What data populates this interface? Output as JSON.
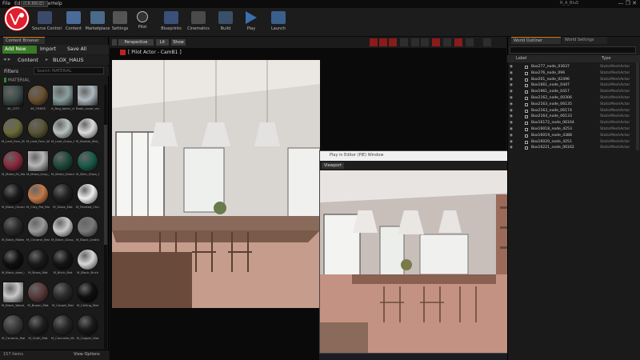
{
  "app": {
    "title_chip": "(CR.BBUZ)",
    "window_title": "R_A_BluS",
    "window_buttons": "— ❐ ✕",
    "brand_color": "#e0202e"
  },
  "menu": [
    "File",
    "Edit",
    "Window",
    "Help"
  ],
  "toolbar": [
    {
      "label": "Save",
      "icon": "save-icon",
      "color": "#3a5a8a"
    },
    {
      "label": "Source Control",
      "icon": "source-control-icon",
      "color": "#3b4a6a"
    },
    {
      "label": "Content",
      "icon": "content-icon",
      "color": "#4a6a9a"
    },
    {
      "label": "Marketplace",
      "icon": "marketplace-icon",
      "color": "#4a6a8a"
    },
    {
      "label": "Settings",
      "icon": "settings-icon",
      "color": "#555"
    },
    {
      "label": "Pilot",
      "icon": "pilot-icon",
      "color": "#333"
    },
    {
      "label": "Blueprints",
      "icon": "blueprints-icon",
      "color": "#3a4f7a"
    },
    {
      "label": "Cinematics",
      "icon": "cinematics-icon",
      "color": "#4a4a4a"
    },
    {
      "label": "Build",
      "icon": "build-icon",
      "color": "#3a4f6a"
    },
    {
      "label": "Play",
      "icon": "play-icon",
      "color": "#3a6fb0"
    },
    {
      "label": "Launch",
      "icon": "launch-icon",
      "color": "#3a5f8a"
    }
  ],
  "content_browser": {
    "tab": "Content Browser",
    "add_new": "Add New",
    "import": "Import",
    "save_all": "Save All",
    "path_root": "Content",
    "path_folder": "BLOX_HAUS",
    "filters": "Filters",
    "search_placeholder": "Search MATERIAL",
    "folder": "MATERIAL",
    "item_count": "157 items",
    "view_options": "View Options",
    "tiles": [
      {
        "name": "4K_CITY",
        "color": "#3e4e4a",
        "sq": true
      },
      {
        "name": "4K_TREES",
        "color": "#6a5030",
        "sq": false
      },
      {
        "name": "A_Rug_fabric_mat",
        "color": "#8aa0a0",
        "sq": true
      },
      {
        "name": "Book_cover_mat_06",
        "color": "#aeb8bf",
        "sq": true
      },
      {
        "name": "M_Leaf_Fern_Mat",
        "color": "#6b6a3a",
        "sq": false
      },
      {
        "name": "M_Leaf_Fern_Wall",
        "color": "#5a5535",
        "sq": false
      },
      {
        "name": "M_Leaf_Grass_Mat",
        "color": "#b8c0c0",
        "sq": false
      },
      {
        "name": "M_Marble_Mat_01",
        "color": "#dcdcdc",
        "sq": false
      },
      {
        "name": "M_Metal_Fe_Mat",
        "color": "#8a2a3e",
        "sq": false
      },
      {
        "name": "M_Metal_Gray_Mat",
        "color": "#b8b8b8",
        "sq": true
      },
      {
        "name": "M_Metal_Green_Mat",
        "color": "#1e4a3a",
        "sq": false
      },
      {
        "name": "M_Wire_Glass_Mat",
        "color": "#1c5c4a",
        "sq": false
      },
      {
        "name": "M_Black_Chrome",
        "color": "#181818",
        "sq": false
      },
      {
        "name": "M_Clay_Pot_Mat",
        "color": "#c47a4a",
        "sq": false
      },
      {
        "name": "M_Glass_Mat",
        "color": "#202020",
        "sq": false
      },
      {
        "name": "M_Painted_Chrome",
        "color": "#eeeeee",
        "sq": false
      },
      {
        "name": "M_Black_Matte_mat",
        "color": "#2a2a2a",
        "sq": false
      },
      {
        "name": "M_Chrome_Mat",
        "color": "#9a9a9a",
        "sq": false
      },
      {
        "name": "M_Black_Gloss_Mat",
        "color": "#c9c9c9",
        "sq": false
      },
      {
        "name": "M_Black_Leather",
        "color": "#7a7a7a",
        "sq": false
      },
      {
        "name": "M_Black_steel_mat",
        "color": "#0f0f0f",
        "sq": false
      },
      {
        "name": "M_Brass_Mat",
        "color": "#1a1a1a",
        "sq": false
      },
      {
        "name": "M_Brick_Mat",
        "color": "#141414",
        "sq": false
      },
      {
        "name": "M_Black_Brick",
        "color": "#d8d8d8",
        "sq": false
      },
      {
        "name": "M_Black_Wood_Mat",
        "color": "#c8c8c8",
        "sq": true
      },
      {
        "name": "M_Brown_Mat",
        "color": "#5a3a3a",
        "sq": false
      },
      {
        "name": "M_Carpet_Mat",
        "color": "#2a2a2a",
        "sq": false
      },
      {
        "name": "M_Ceiling_Mat",
        "color": "#0f0f0f",
        "sq": false
      },
      {
        "name": "M_Ceramic_Mat",
        "color": "#3a3a3a",
        "sq": false
      },
      {
        "name": "M_Cloth_Mat",
        "color": "#1e1e1e",
        "sq": false
      },
      {
        "name": "M_Concrete_Mat",
        "color": "#262626",
        "sq": false
      },
      {
        "name": "M_Copper_Mat",
        "color": "#1a1a1a",
        "sq": false
      }
    ]
  },
  "viewport": {
    "perspective": "Perspective",
    "lit": "Lit",
    "show": "Show",
    "pilot_label": "[ Pilot Actor - CamB1 ]"
  },
  "pie_window": {
    "title": "Play in Editor (PIE) Window",
    "address": "Viewport"
  },
  "outliner": {
    "tab1": "World Outliner",
    "tab2": "World Settings",
    "label_header": "Label",
    "type_header": "Type",
    "rows": [
      {
        "label": "Box277_node_03637",
        "type": "StaticMeshActor"
      },
      {
        "label": "Box276_node_096",
        "type": "StaticMeshActor"
      },
      {
        "label": "Box201_node_02496",
        "type": "StaticMeshActor"
      },
      {
        "label": "Box1661_node_0447",
        "type": "StaticMeshActor"
      },
      {
        "label": "Box1961_node_0417",
        "type": "StaticMeshActor"
      },
      {
        "label": "Box2162_node_00306",
        "type": "StaticMeshActor"
      },
      {
        "label": "Box2163_node_06135",
        "type": "StaticMeshActor"
      },
      {
        "label": "Box2163_node_06174",
        "type": "StaticMeshActor"
      },
      {
        "label": "Box2164_node_06133",
        "type": "StaticMeshActor"
      },
      {
        "label": "Box16172_node_06164",
        "type": "StaticMeshActor"
      },
      {
        "label": "Box16018_node_4253",
        "type": "StaticMeshActor"
      },
      {
        "label": "Box16019_node_4388",
        "type": "StaticMeshActor"
      },
      {
        "label": "Box16020_node_4251",
        "type": "StaticMeshActor"
      },
      {
        "label": "Box16221_node_06162",
        "type": "StaticMeshActor"
      }
    ]
  }
}
